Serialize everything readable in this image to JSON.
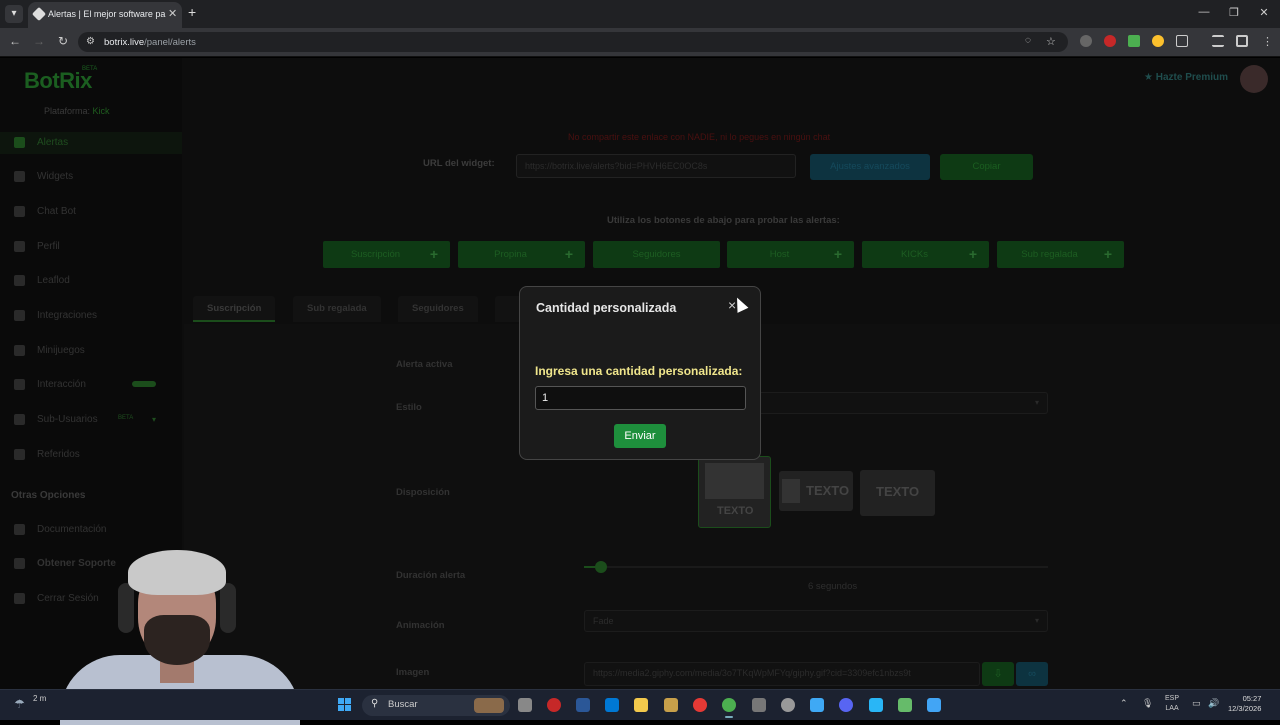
{
  "browser": {
    "tab_title": "Alertas | El mejor software para",
    "url_host": "botrix.live",
    "url_path": "/panel/alerts"
  },
  "sidebar": {
    "logo": "BotRix",
    "logo_badge": "BETA",
    "platform_label": "Plataforma:",
    "platform_value": "Kick",
    "items": [
      {
        "label": "Alertas"
      },
      {
        "label": "Widgets"
      },
      {
        "label": "Chat Bot"
      },
      {
        "label": "Perfil"
      },
      {
        "label": "Leaflod"
      },
      {
        "label": "Integraciones"
      },
      {
        "label": "Minijuegos"
      },
      {
        "label": "Interacción"
      },
      {
        "label": "Sub-Usuarios"
      },
      {
        "label": "Referidos"
      }
    ],
    "section_other": "Otras Opciones",
    "other_items": [
      {
        "label": "Documentación"
      },
      {
        "label": "Obtener Soporte"
      },
      {
        "label": "Cerrar Sesión"
      }
    ],
    "badge_beta": "BETA"
  },
  "header": {
    "premium": "Hazte Premium"
  },
  "main": {
    "warning": "No compartir este enlace con NADIE, ni lo pegues en ningún chat",
    "widget_label": "URL del widget:",
    "widget_url": "https://botrix.live/alerts?bid=PHVH6EC0OC8s",
    "advanced_btn": "Ajustes avanzados",
    "copy_btn": "Copiar",
    "hint": "Utiliza los botones de abajo para probar las alertas:",
    "test_buttons": [
      {
        "label": "Suscripción"
      },
      {
        "label": "Propina"
      },
      {
        "label": "Seguidores"
      },
      {
        "label": "Host"
      },
      {
        "label": "KICKs"
      },
      {
        "label": "Sub regalada"
      }
    ],
    "tabs": [
      {
        "label": "Suscripción"
      },
      {
        "label": "Sub regalada"
      },
      {
        "label": "Seguidores"
      }
    ],
    "fields": {
      "active_label": "Alerta activa",
      "style_label": "Estilo",
      "layout_label": "Disposición",
      "layout_text": "TEXTO",
      "duration_label": "Duración alerta",
      "duration_value": "6 segundos",
      "animation_label": "Animación",
      "animation_value": "Fade",
      "image_label": "Imagen",
      "image_url": "https://media2.giphy.com/media/3o7TKqWpMFYq/giphy.gif?cid=3309efc1nbzs9t"
    }
  },
  "modal": {
    "title": "Cantidad personalizada",
    "close": "×",
    "label": "Ingresa una cantidad personalizada:",
    "input_value": "1",
    "submit": "Enviar"
  },
  "taskbar": {
    "weather": "2 m",
    "search": "Buscar",
    "lang_top": "ESP",
    "lang_bottom": "LAA",
    "time": "05:27",
    "date": "12/3/2026"
  }
}
